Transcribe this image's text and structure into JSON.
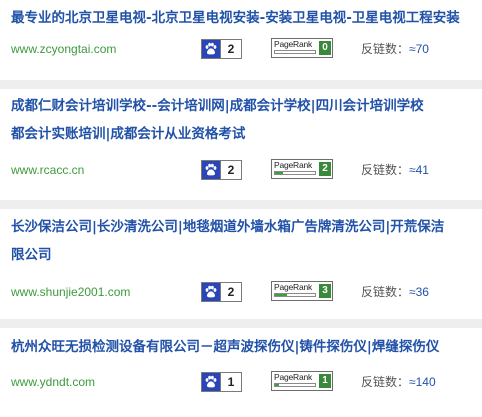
{
  "results": [
    {
      "title_lines": [
        "最专业的北京卫星电视-北京卫星电视安装-安装卫星电视-卫星电视工程安装"
      ],
      "url": "www.zcyongtai.com",
      "baidu_weight": "2",
      "pagerank_label": "PageRank",
      "pagerank": "0",
      "pagerank_fraction": 0.0,
      "backlinks_label": "反链数：",
      "backlinks": "≈70"
    },
    {
      "title_lines": [
        "成都仁财会计培训学校--会计培训网|成都会计学校|四川会计培训学校",
        "都会计实账培训|成都会计从业资格考试"
      ],
      "url": "www.rcacc.cn",
      "baidu_weight": "2",
      "pagerank_label": "PageRank",
      "pagerank": "2",
      "pagerank_fraction": 0.2,
      "backlinks_label": "反链数：",
      "backlinks": "≈41"
    },
    {
      "title_lines": [
        "长沙保洁公司|长沙清洗公司|地毯烟道外墙水箱广告牌清洗公司|开荒保洁",
        "限公司"
      ],
      "url": "www.shunjie2001.com",
      "baidu_weight": "2",
      "pagerank_label": "PageRank",
      "pagerank": "3",
      "pagerank_fraction": 0.3,
      "backlinks_label": "反链数：",
      "backlinks": "≈36"
    },
    {
      "title_lines": [
        "杭州众旺无损检测设备有限公司－超声波探伤仪|铸件探伤仪|焊缝探伤仪"
      ],
      "url": "www.ydndt.com",
      "baidu_weight": "1",
      "pagerank_label": "PageRank",
      "pagerank": "1",
      "pagerank_fraction": 0.1,
      "backlinks_label": "反链数：",
      "backlinks": "≈140"
    }
  ],
  "colors": {
    "title": "#2152a8",
    "url": "#3d9a3d",
    "separator": "#eeeeee",
    "baidu_paw": "#2945b8",
    "pagerank_box": "#39893a",
    "pagerank_bar": "#3aa03a"
  },
  "icons": {
    "baidu_weight": "paw-icon"
  }
}
